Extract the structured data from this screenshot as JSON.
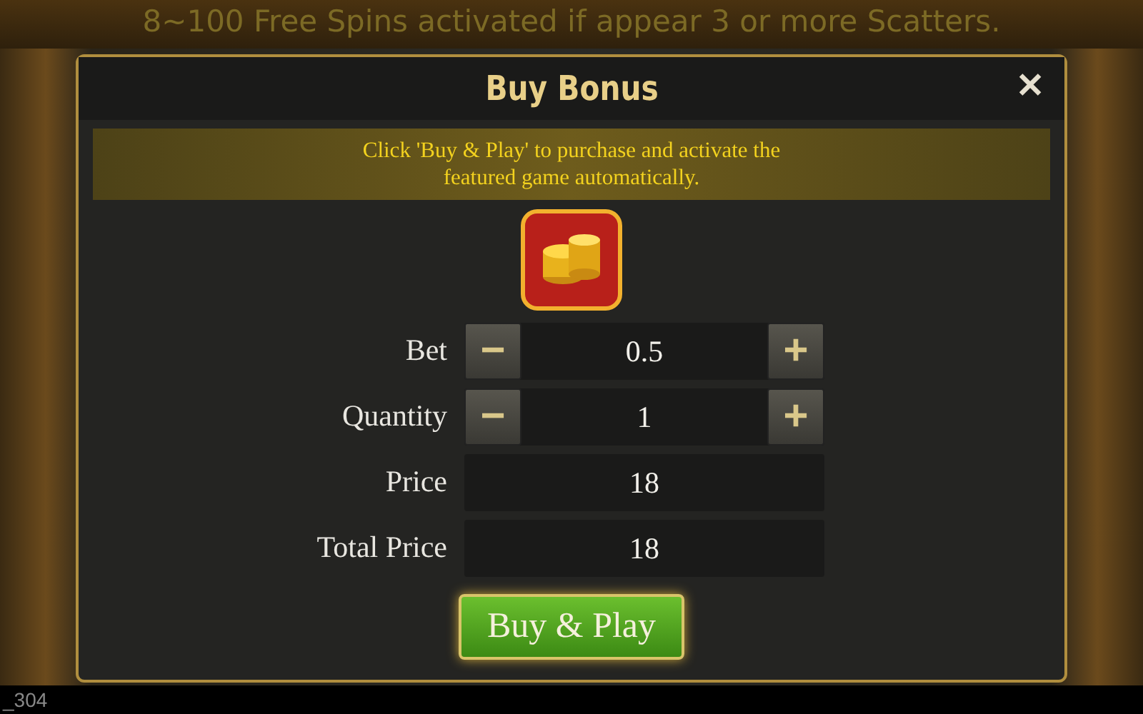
{
  "banner": {
    "text": "8~100 Free Spins activated if appear 3 or more Scatters."
  },
  "dialog": {
    "title": "Buy Bonus",
    "close": "✕",
    "notice": "Click 'Buy & Play' to purchase and activate the featured game automatically.",
    "fields": [
      {
        "kind": "stepper",
        "label": "Bet",
        "value": "0.5",
        "minus": "−",
        "plus": "+"
      },
      {
        "kind": "stepper",
        "label": "Quantity",
        "value": "1",
        "minus": "−",
        "plus": "+"
      },
      {
        "kind": "readout",
        "label": "Price",
        "value": "18"
      },
      {
        "kind": "readout",
        "label": "Total Price",
        "value": "18"
      }
    ],
    "button": "Buy & Play"
  },
  "footer": {
    "text": "_304"
  }
}
